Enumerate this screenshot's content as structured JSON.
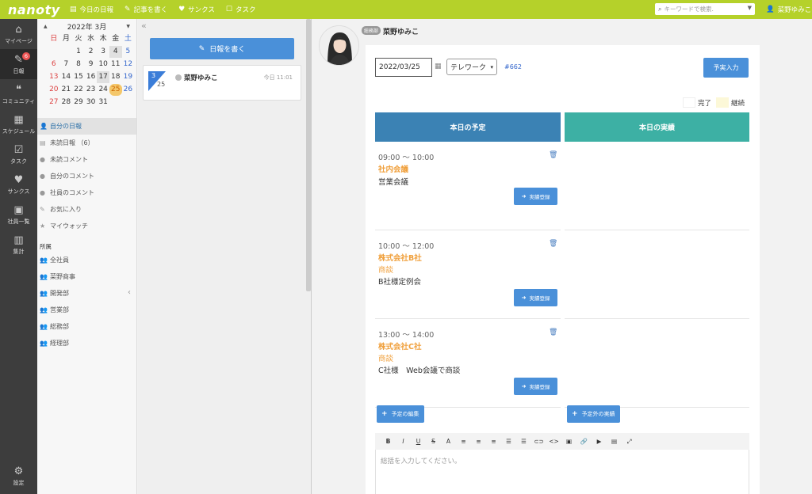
{
  "top": {
    "logo": "nanoty",
    "nav": [
      {
        "label": "今日の日報",
        "icon": "document-icon",
        "glyph": "▤"
      },
      {
        "label": "記事を書く",
        "icon": "chat-icon",
        "glyph": "✎"
      },
      {
        "label": "サンクス",
        "icon": "heart-icon",
        "glyph": "♥"
      },
      {
        "label": "タスク",
        "icon": "clipboard-icon",
        "glyph": "☐"
      }
    ],
    "search_placeholder": "キーワードで検索.",
    "user": "菜野ゆみこ"
  },
  "rail": {
    "items": [
      {
        "label": "マイページ",
        "icon": "home-icon",
        "glyph": "⌂"
      },
      {
        "label": "日報",
        "icon": "edit-icon",
        "glyph": "✎",
        "badge": "6"
      },
      {
        "label": "コミュニティ",
        "icon": "comments-icon",
        "glyph": "❝"
      },
      {
        "label": "スケジュール",
        "icon": "calendar-icon",
        "glyph": "▦"
      },
      {
        "label": "タスク",
        "icon": "task-icon",
        "glyph": "☑"
      },
      {
        "label": "サンクス",
        "icon": "heart-icon",
        "glyph": "♥"
      },
      {
        "label": "社員一覧",
        "icon": "address-book-icon",
        "glyph": "▣"
      },
      {
        "label": "集計",
        "icon": "bar-chart-icon",
        "glyph": "▥"
      }
    ],
    "settings": {
      "label": "設定",
      "icon": "gear-icon",
      "glyph": "⚙"
    }
  },
  "calendar": {
    "title": "2022年 3月",
    "dow": [
      "日",
      "月",
      "火",
      "水",
      "木",
      "金",
      "土"
    ],
    "weeks": [
      [
        "",
        "",
        "1",
        "2",
        "3",
        "4",
        "5"
      ],
      [
        "6",
        "7",
        "8",
        "9",
        "10",
        "11",
        "12"
      ],
      [
        "13",
        "14",
        "15",
        "16",
        "17",
        "18",
        "19"
      ],
      [
        "20",
        "21",
        "22",
        "23",
        "24",
        "25",
        "26"
      ],
      [
        "27",
        "28",
        "29",
        "30",
        "31",
        "",
        ""
      ]
    ],
    "today": "25"
  },
  "menu": {
    "items": [
      {
        "label": "自分の日報",
        "glyph": "👤"
      },
      {
        "label": "未読日報 （6）",
        "glyph": "▤"
      },
      {
        "label": "未読コメント",
        "glyph": "●"
      },
      {
        "label": "自分のコメント",
        "glyph": "●"
      },
      {
        "label": "社員のコメント",
        "glyph": "●"
      },
      {
        "label": "お気に入り",
        "glyph": "✎"
      },
      {
        "label": "マイウォッチ",
        "glyph": "★"
      }
    ],
    "section_label": "所属",
    "groups": [
      "全社員",
      "菜野商事",
      "開発部",
      "営業部",
      "総務部",
      "経理部"
    ]
  },
  "list": {
    "write_label": "日報を書く",
    "card": {
      "month": "3",
      "day": "25",
      "author": "菜野ゆみこ",
      "time": "今日 11:01"
    }
  },
  "main": {
    "dept": "総務部",
    "user_name": "菜野ゆみこ",
    "date_value": "2022/03/25",
    "work_style": "テレワーク",
    "ref": "#662",
    "plan_button": "予実入力",
    "legend_done": "完了",
    "legend_continue": "継続",
    "plan_header": "本日の予定",
    "actual_header": "本日の実績",
    "register_label": "実績登録",
    "schedules": [
      {
        "time": "09:00 ～ 10:00",
        "company": "社内会議",
        "category": "",
        "title": "営業会議"
      },
      {
        "time": "10:00 ～ 12:00",
        "company": "株式会社B社",
        "category": "商談",
        "title": "B社様定例会"
      },
      {
        "time": "13:00 ～ 14:00",
        "company": "株式会社C社",
        "category": "商談",
        "title": "C社様　Web会議で商談"
      }
    ],
    "edit_plan": "予定の編集",
    "add_unplanned": "予定外の実績",
    "toolbar": [
      "B",
      "I",
      "U",
      "S",
      "A",
      "≡",
      "≡",
      "≡",
      "☰",
      "☰",
      "⊂⊃",
      "<>",
      "▣",
      "🔗",
      "▶",
      "▤",
      "⤢"
    ],
    "editor_placeholder": "総括を入力してください。"
  }
}
